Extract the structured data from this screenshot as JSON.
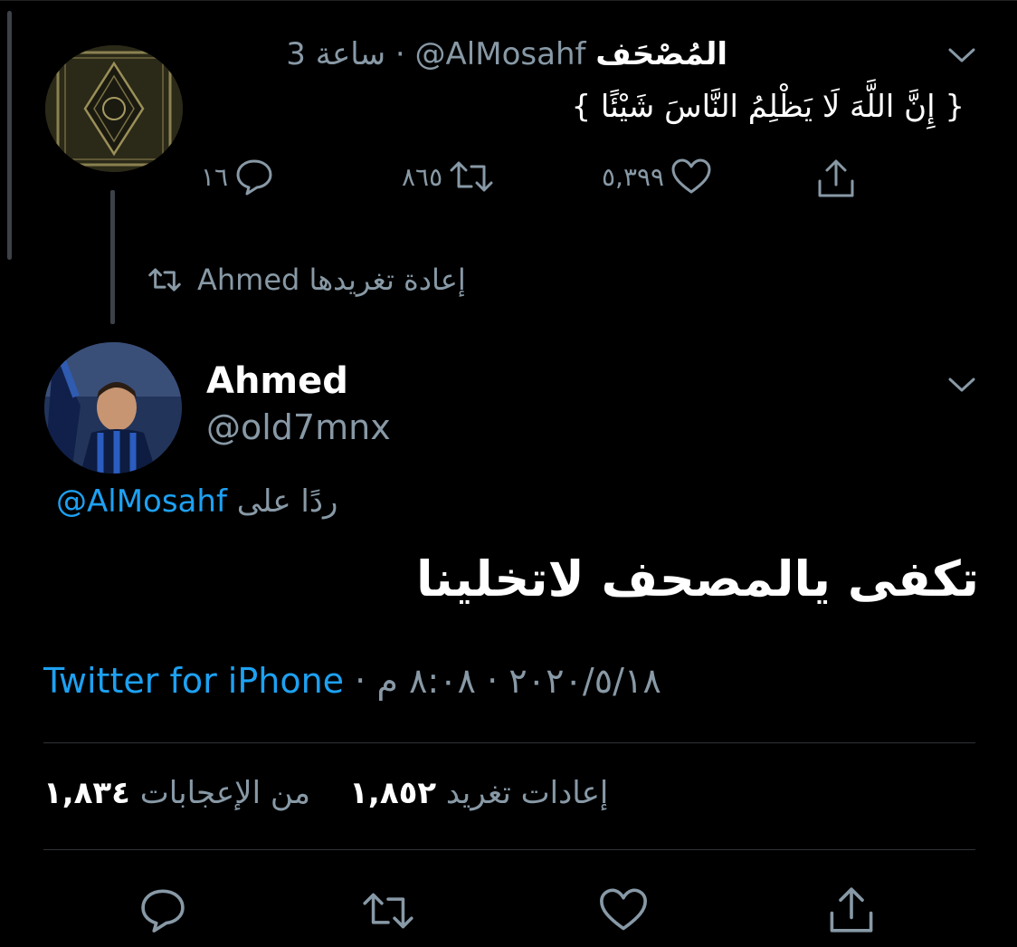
{
  "tweet1": {
    "display_name": "المُصْحَف",
    "handle": "@AlMosahf",
    "time": "3 ساعة",
    "separator": "·",
    "text": "{ إِنَّ اللَّهَ لَا يَظْلِمُ النَّاسَ شَيْئًا }",
    "reply_count": "١٦",
    "retweet_count": "٨٦٥",
    "like_count": "٥,٣٩٩"
  },
  "retweet_banner": {
    "text": "Ahmed إعادة تغريدها"
  },
  "tweet2": {
    "display_name": "Ahmed",
    "handle": "@old7mnx",
    "replying_label": "ردًا على",
    "replying_handle": "@AlMosahf",
    "text": "تكفى يالمصحف لاتخلينا",
    "time": "٨:٠٨ م",
    "date": "٢٠٢٠/٥/١٨",
    "sep": "·",
    "source": "Twitter for iPhone",
    "likes_value": "١,٨٣٤",
    "likes_label": "من الإعجابات",
    "retweets_value": "١,٨٥٢",
    "retweets_label": "إعادات تغريد"
  },
  "colors": {
    "background": "#000000",
    "text": "#ffffff",
    "secondary": "#8899a6",
    "link": "#1da1f2"
  },
  "icons": [
    "chevron-down-icon",
    "reply-icon",
    "retweet-icon",
    "like-icon",
    "share-icon"
  ]
}
